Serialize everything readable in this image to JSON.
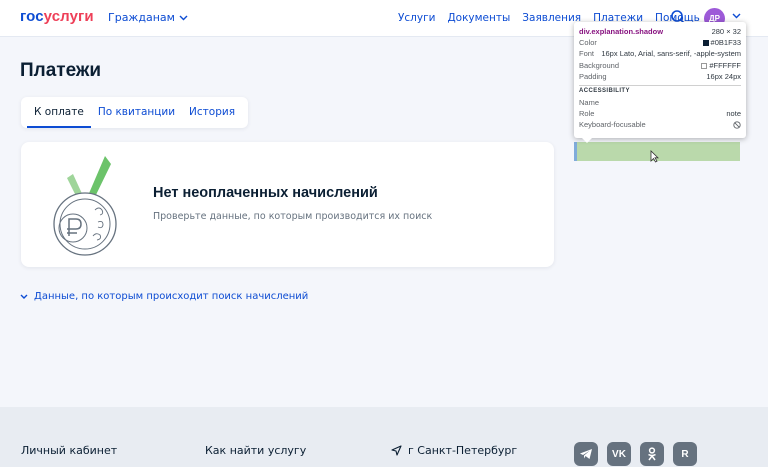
{
  "header": {
    "logo_part1": "гос",
    "logo_part2": "услуги",
    "audience_label": "Гражданам",
    "nav": [
      "Услуги",
      "Документы",
      "Заявления",
      "Платежи",
      "Помощь"
    ],
    "avatar_initials": "ДР"
  },
  "main": {
    "title": "Платежи",
    "tabs": [
      "К оплате",
      "По квитанции",
      "История"
    ],
    "empty_state": {
      "title": "Нет неоплаченных начислений",
      "description": "Проверьте данные, по которым производится их поиск"
    },
    "expander_label": "Данные, по которым происходит поиск начислений"
  },
  "footer": {
    "links": [
      "Личный кабинет",
      "Как найти услугу"
    ],
    "city": "г Санкт-Петербург",
    "social": [
      "telegram",
      "vk",
      "odnoklassniki",
      "rutube"
    ]
  },
  "devtools": {
    "selector": "div.explanation.shadow",
    "size": "280 × 32",
    "rows": [
      {
        "label": "Color",
        "value": "#0B1F33"
      },
      {
        "label": "Font",
        "value": "16px Lato, Arial, sans-serif, -apple-system"
      },
      {
        "label": "Background",
        "value": "#FFFFFF"
      },
      {
        "label": "Padding",
        "value": "16px 24px"
      }
    ],
    "section": "ACCESSIBILITY",
    "a11y": [
      {
        "label": "Name",
        "value": ""
      },
      {
        "label": "Role",
        "value": "note"
      },
      {
        "label": "Keyboard-focusable",
        "value": ""
      }
    ]
  },
  "colors": {
    "brand_blue": "#0d4cd3",
    "brand_red": "#ee3f58",
    "text": "#0b1f33",
    "highlight": "#b7d8a7"
  }
}
